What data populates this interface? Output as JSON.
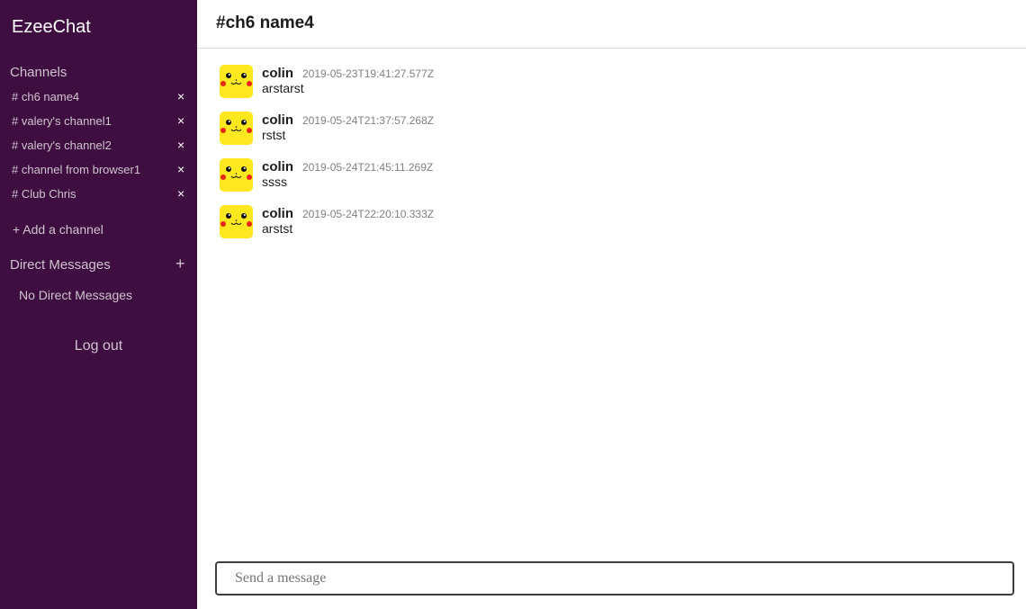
{
  "app": {
    "title": "EzeeChat"
  },
  "sidebar": {
    "channels_title": "Channels",
    "channels": [
      {
        "label": "# ch6 name4",
        "remove": "×"
      },
      {
        "label": "# valery's channel1",
        "remove": "×"
      },
      {
        "label": "# valery's channel2",
        "remove": "×"
      },
      {
        "label": "# channel from browser1",
        "remove": "×"
      },
      {
        "label": "# Club Chris",
        "remove": "×"
      }
    ],
    "add_channel": "+ Add a channel",
    "dm_title": "Direct Messages",
    "dm_add": "+",
    "no_dm": "No Direct Messages",
    "logout": "Log out"
  },
  "main": {
    "channel_name": "#ch6 name4",
    "messages": [
      {
        "username": "colin",
        "timestamp": "2019-05-23T19:41:27.577Z",
        "text": "arstarst"
      },
      {
        "username": "colin",
        "timestamp": "2019-05-24T21:37:57.268Z",
        "text": "rstst"
      },
      {
        "username": "colin",
        "timestamp": "2019-05-24T21:45:11.269Z",
        "text": "ssss"
      },
      {
        "username": "colin",
        "timestamp": "2019-05-24T22:20:10.333Z",
        "text": "arstst"
      }
    ],
    "composer": {
      "placeholder": "Send a message",
      "value": ""
    }
  },
  "icons": {
    "avatar": "pikachu-avatar-icon",
    "remove": "close-icon",
    "add": "plus-icon"
  },
  "colors": {
    "sidebar_bg": "#3f0e40",
    "avatar_bg": "#ffe81f",
    "cheek": "#e8261a"
  }
}
